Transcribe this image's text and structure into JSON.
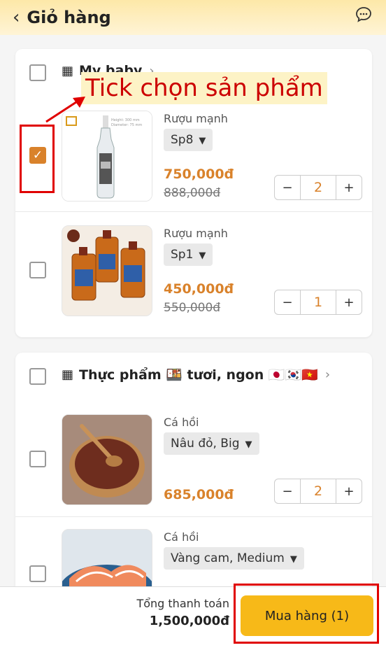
{
  "header": {
    "title": "Giỏ hàng",
    "back_icon": "‹"
  },
  "annotation": {
    "text": "Tick chọn sản phẩm"
  },
  "shops": [
    {
      "name": "My baby",
      "items": [
        {
          "name": "Rượu mạnh",
          "variant": "Sp8",
          "price": "750,000đ",
          "old_price": "888,000đ",
          "qty": "2",
          "checked": true
        },
        {
          "name": "Rượu mạnh",
          "variant": "Sp1",
          "price": "450,000đ",
          "old_price": "550,000đ",
          "qty": "1",
          "checked": false
        }
      ]
    },
    {
      "name": "Thực phẩm 🍱 tươi, ngon 🇯🇵🇰🇷🇻🇳",
      "items": [
        {
          "name": "Cá hồi",
          "variant": "Nâu đỏ, Big",
          "price": "685,000đ",
          "qty": "2",
          "checked": false
        },
        {
          "name": "Cá hồi",
          "variant": "Vàng cam, Medium",
          "checked": false
        }
      ]
    }
  ],
  "footer": {
    "total_label": "Tổng thanh toán",
    "total_value": "1,500,000đ",
    "buy_label": "Mua hàng (1)"
  },
  "colors": {
    "accent": "#d9822b",
    "buy_button": "#f7b918",
    "annotation": "#e00000"
  }
}
